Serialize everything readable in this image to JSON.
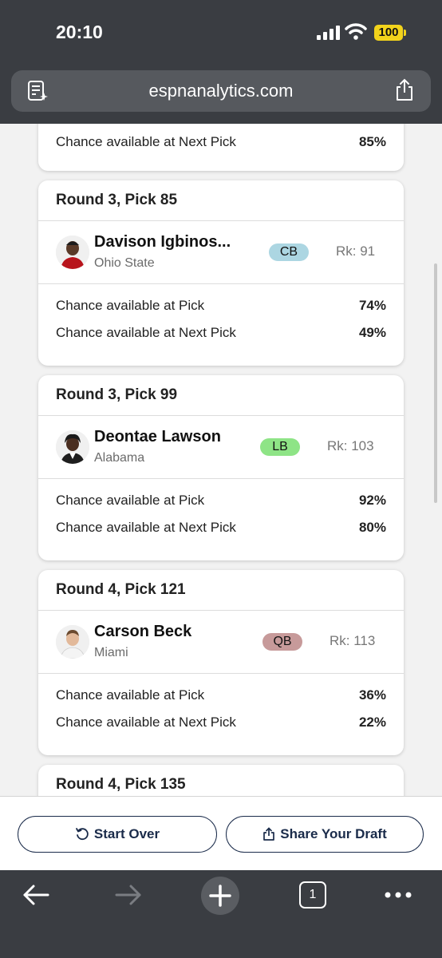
{
  "status": {
    "time": "20:10",
    "battery": "100"
  },
  "browser": {
    "url": "espnanalytics.com"
  },
  "partial_card": {
    "stat_label": "Chance available at Next Pick",
    "stat_value": "85%"
  },
  "cards": [
    {
      "heading": "Round 3, Pick 85",
      "player": "Davison Igbinos...",
      "school": "Ohio State",
      "position": "CB",
      "rank": "Rk: 91",
      "stats": [
        {
          "label": "Chance available at Pick",
          "value": "74%"
        },
        {
          "label": "Chance available at Next Pick",
          "value": "49%"
        }
      ]
    },
    {
      "heading": "Round 3, Pick 99",
      "player": "Deontae Lawson",
      "school": "Alabama",
      "position": "LB",
      "rank": "Rk: 103",
      "stats": [
        {
          "label": "Chance available at Pick",
          "value": "92%"
        },
        {
          "label": "Chance available at Next Pick",
          "value": "80%"
        }
      ]
    },
    {
      "heading": "Round 4, Pick 121",
      "player": "Carson Beck",
      "school": "Miami",
      "position": "QB",
      "rank": "Rk: 113",
      "stats": [
        {
          "label": "Chance available at Pick",
          "value": "36%"
        },
        {
          "label": "Chance available at Next Pick",
          "value": "22%"
        }
      ]
    }
  ],
  "partial_bottom_card": {
    "heading": "Round 4, Pick 135"
  },
  "actions": {
    "start_over": "Start Over",
    "share": "Share Your Draft"
  },
  "nav": {
    "tab_count": "1"
  },
  "colors": {
    "cb": "#acd6e2",
    "lb": "#8ee486",
    "qb": "#c79a9a",
    "navy": "#1a2b4a",
    "chrome": "#3a3d42"
  },
  "icons": [
    "reader-icon",
    "share-icon",
    "avatar",
    "restart-icon",
    "back-arrow-icon",
    "forward-arrow-icon",
    "plus-icon",
    "tabs-icon",
    "more-icon"
  ]
}
